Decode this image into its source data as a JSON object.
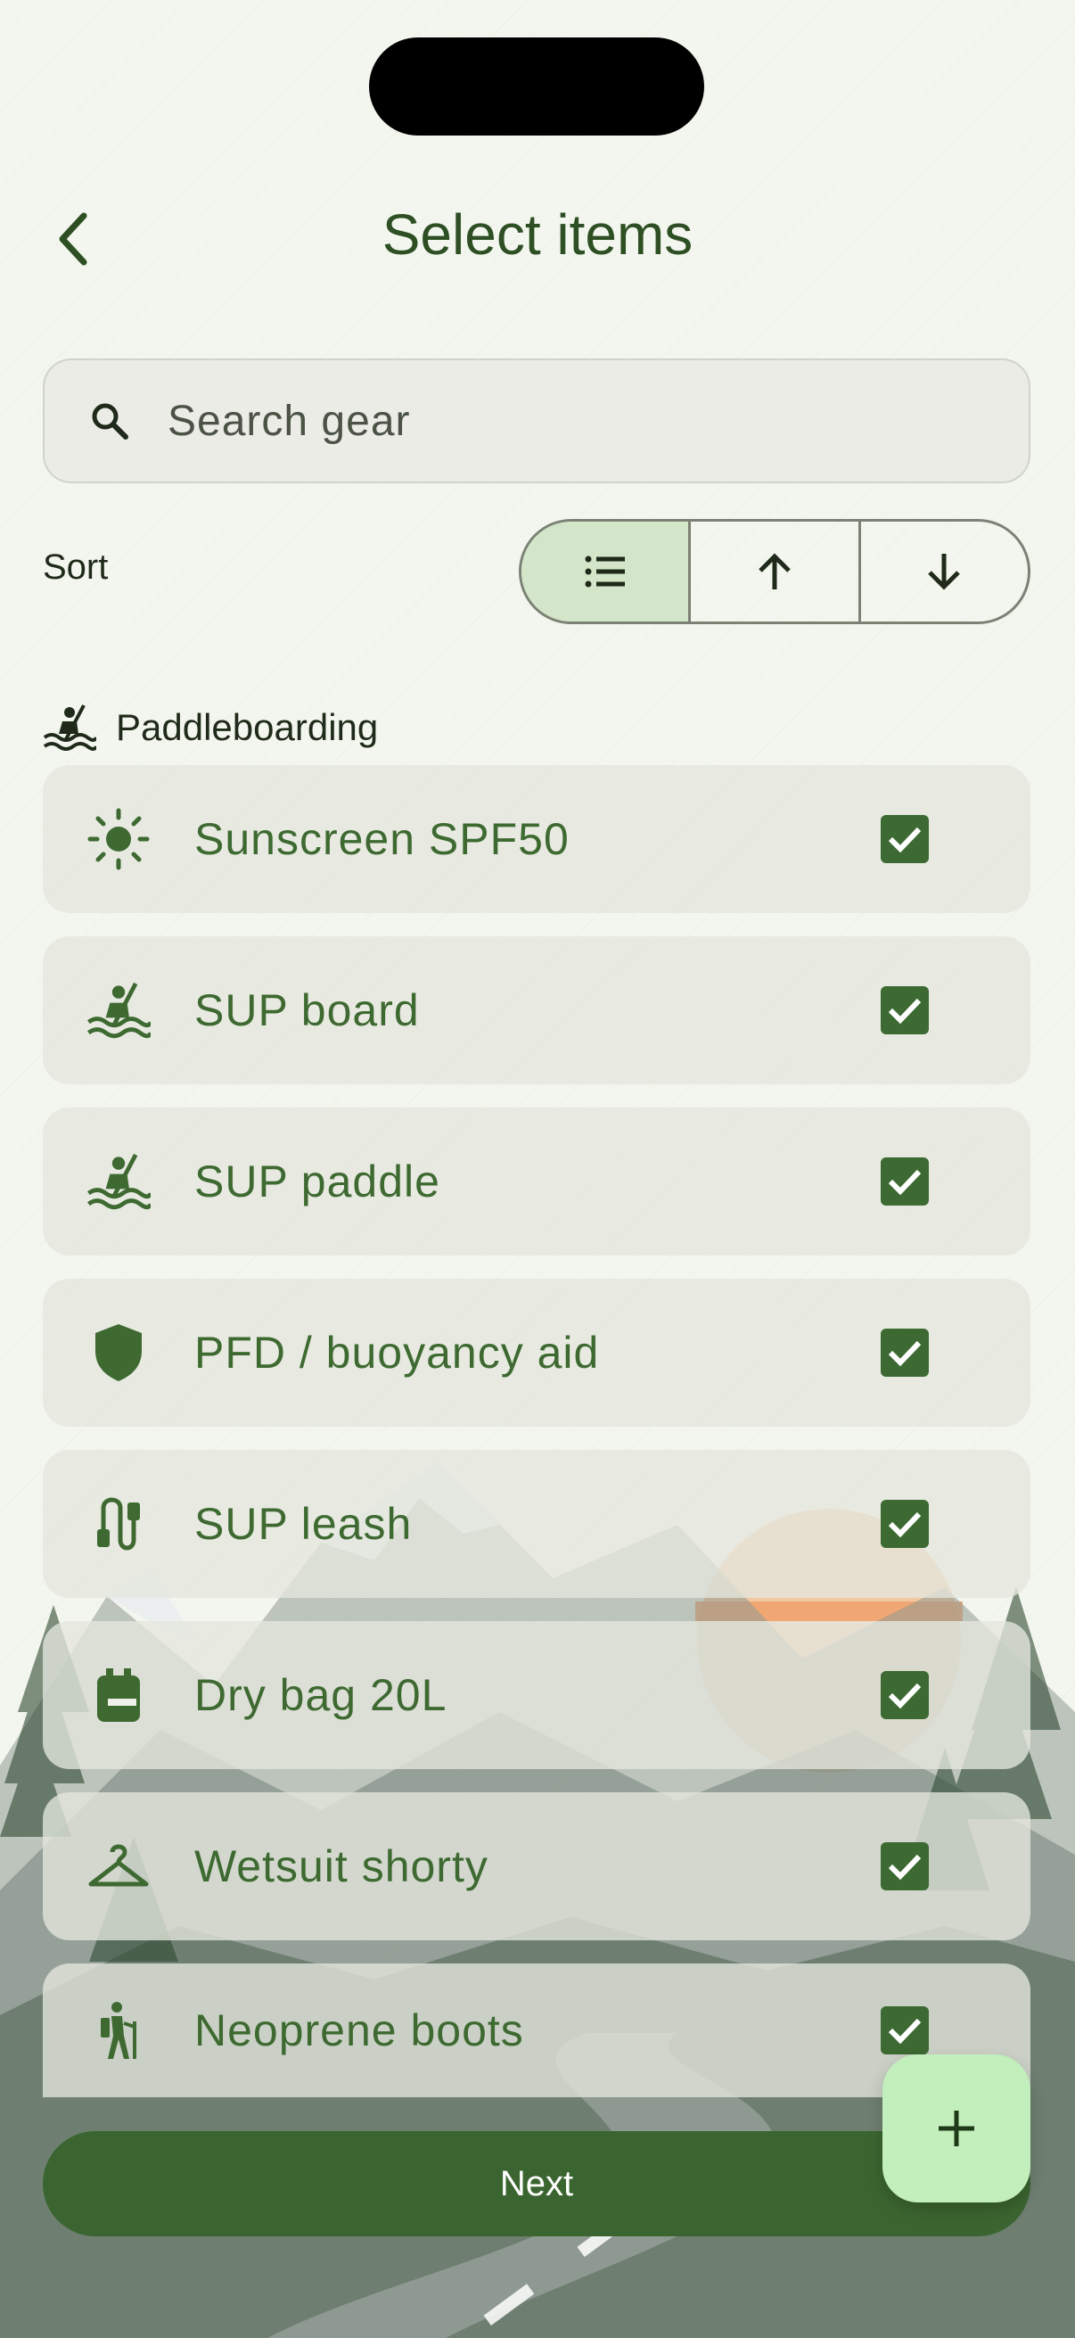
{
  "header": {
    "title": "Select items",
    "back_icon": "chevron-left-icon"
  },
  "search": {
    "placeholder": "Search gear",
    "icon": "search-icon"
  },
  "sort": {
    "label": "Sort",
    "options": [
      {
        "icon": "list-icon",
        "selected": true
      },
      {
        "icon": "arrow-up-icon",
        "selected": false
      },
      {
        "icon": "arrow-down-icon",
        "selected": false
      }
    ]
  },
  "section": {
    "title": "Paddleboarding",
    "icon": "kayak-icon"
  },
  "items": [
    {
      "label": "Sunscreen SPF50",
      "icon": "sun-icon",
      "checked": true
    },
    {
      "label": "SUP board",
      "icon": "kayak-icon",
      "checked": true
    },
    {
      "label": "SUP paddle",
      "icon": "kayak-icon",
      "checked": true
    },
    {
      "label": "PFD / buoyancy aid",
      "icon": "shield-icon",
      "checked": true
    },
    {
      "label": "SUP leash",
      "icon": "cable-icon",
      "checked": true
    },
    {
      "label": "Dry bag 20L",
      "icon": "backpack-icon",
      "checked": true
    },
    {
      "label": "Wetsuit shorty",
      "icon": "hanger-icon",
      "checked": true
    },
    {
      "label": "Neoprene boots",
      "icon": "hiker-icon",
      "checked": true
    }
  ],
  "footer": {
    "next_label": "Next",
    "fab_icon": "plus-icon"
  },
  "colors": {
    "primary": "#3b6530",
    "accent": "#c2efbb",
    "background": "#f3f6ee"
  }
}
